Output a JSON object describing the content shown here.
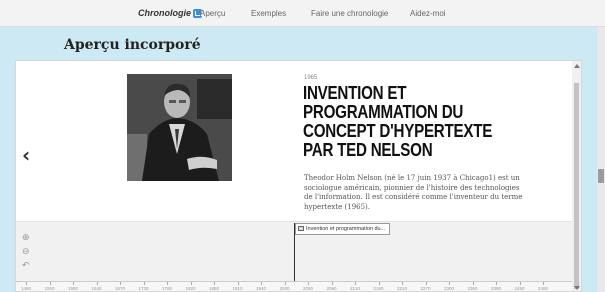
{
  "nav": {
    "brand": "Chronologie",
    "links": [
      "Aperçu",
      "Exemples",
      "Faire une chronologie",
      "Aidez-moi"
    ]
  },
  "page": {
    "heading": "Aperçu incorporé"
  },
  "slide": {
    "date": "1965",
    "headline": "INVENTION ET PROGRAMMATION DU CONCEPT D'HYPERTEXTE PAR TED NELSON",
    "body": "Theodor Holm Nelson (né le 17 juin 1937 à Chicago1) est un sociologue américain, pionnier de l'histoire des technologies de l'information. Il est considéré comme l'inventeur du terme hypertexte (1965).",
    "prev_glyph": "‹"
  },
  "timeline": {
    "flag_label": "Invention et programmation du...",
    "ticks": [
      "1490",
      "1550",
      "1580",
      "1640",
      "1670",
      "1730",
      "1760",
      "1820",
      "1850",
      "1910",
      "1940",
      "2000",
      "2030",
      "2090",
      "2120",
      "2180",
      "2210",
      "2270",
      "2300",
      "2360",
      "2390",
      "2450",
      "2480"
    ]
  },
  "colors": {
    "page_bg": "#cde9f4",
    "brand_blue": "#3b8fd6"
  }
}
